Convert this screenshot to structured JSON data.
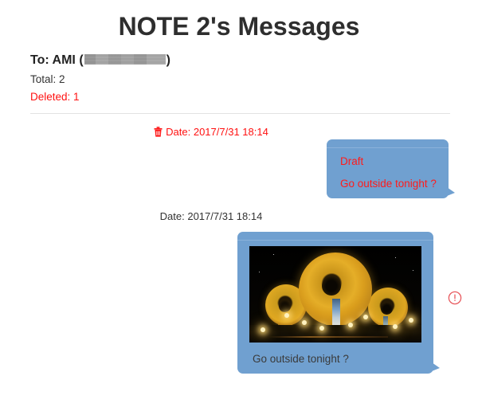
{
  "header": {
    "title": "NOTE 2's Messages",
    "to_label": "To: AMI (",
    "to_close": ")",
    "redacted_name": "",
    "total": "Total: 2",
    "deleted": "Deleted: 1"
  },
  "colors": {
    "bubble_blue": "#70a0d0",
    "deleted_red": "#ff1111",
    "draft_red": "#ff1b1b",
    "title_gray": "#2e2e2e",
    "caption_gray": "#3a3a3a",
    "warning_red": "#e8595e"
  },
  "messages": [
    {
      "id": "message-1",
      "date": "Date: 2017/7/31 18:14",
      "deleted": true,
      "trash_icon": "trash-icon",
      "draft_label": "Draft",
      "text": "Go outside tonight ?",
      "has_photo": false
    },
    {
      "id": "message-2",
      "date": "Date: 2017/7/31 18:14",
      "deleted": false,
      "text": "Go outside tonight ?",
      "has_photo": true,
      "photo_alt": "night photo of illuminated golden dome structures",
      "status_icon": "warning-circle-icon"
    }
  ]
}
